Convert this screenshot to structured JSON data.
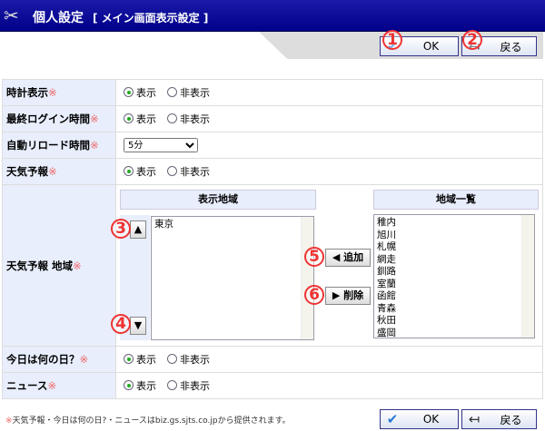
{
  "header": {
    "title": "個人設定",
    "subtitle": "[ メイン画面表示設定 ]",
    "icon": "tools-icon"
  },
  "toolbar": {
    "ok_label": "OK",
    "back_label": "戻る"
  },
  "annotations": [
    "1",
    "2",
    "3",
    "4",
    "5",
    "6"
  ],
  "required_mark": "※",
  "rows": [
    {
      "label": "時計表示",
      "options": [
        "表示",
        "非表示"
      ],
      "selected": 0
    },
    {
      "label": "最終ログイン時間",
      "options": [
        "表示",
        "非表示"
      ],
      "selected": 0
    },
    {
      "label": "自動リロード時間",
      "select_value": "5分"
    },
    {
      "label": "天気予報",
      "options": [
        "表示",
        "非表示"
      ],
      "selected": 0
    },
    {
      "label": "天気予報 地域"
    },
    {
      "label": "今日は何の日？",
      "options": [
        "表示",
        "非表示"
      ],
      "selected": 0
    },
    {
      "label": "ニュース",
      "options": [
        "表示",
        "非表示"
      ],
      "selected": 0
    }
  ],
  "weather_area": {
    "display_header": "表示地域",
    "display_items": [
      "東京"
    ],
    "list_header": "地域一覧",
    "list_items": [
      "稚内",
      "旭川",
      "札幌",
      "網走",
      "釧路",
      "室蘭",
      "函館",
      "青森",
      "秋田",
      "盛岡"
    ],
    "up_label": "▲",
    "down_label": "▼",
    "add_label": "◀ 追加",
    "remove_label": "▶ 削除"
  },
  "footer": {
    "note": "天気予報・今日は何の日?・ニュースはbiz.gs.sjts.co.jpから提供されます。"
  }
}
